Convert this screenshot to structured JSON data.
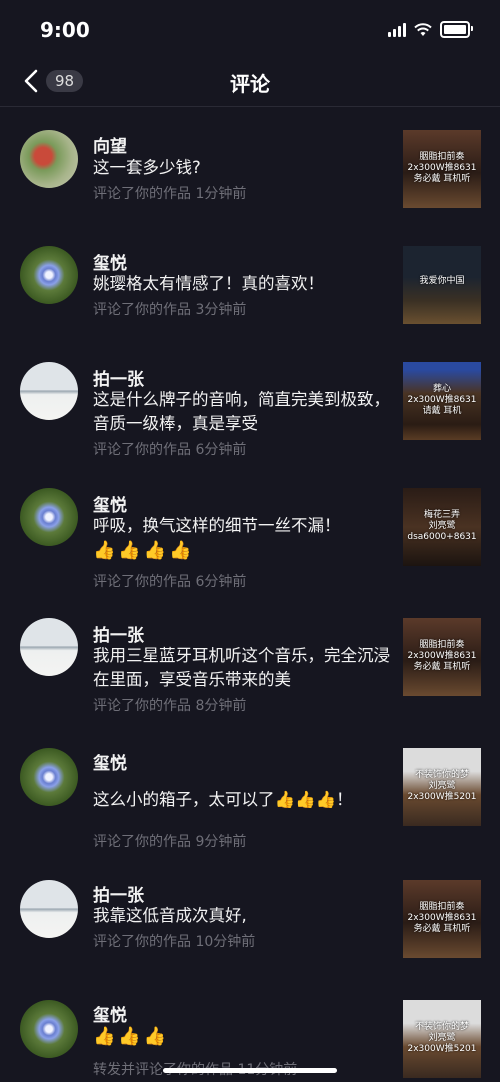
{
  "status": {
    "time": "9:00"
  },
  "nav": {
    "count": "98",
    "title": "评论"
  },
  "comments": [
    {
      "name": "向望",
      "text": "这一套多少钱?",
      "meta": "评论了你的作品  1分钟前",
      "thumb": "胭脂扣前奏\n2x300W推8631\n务必戴  耳机听"
    },
    {
      "name": "玺悦",
      "text": "姚璎格太有情感了！真的喜欢！",
      "meta": "评论了你的作品  3分钟前",
      "thumb": "我爱你中国"
    },
    {
      "name": "拍一张",
      "text": "这是什么牌子的音响，简直完美到极致，音质一级棒，真是享受",
      "meta": "评论了你的作品  6分钟前",
      "thumb": "葬心\n2x300W推8631\n请戴  耳机"
    },
    {
      "name": "玺悦",
      "text": "呼吸，换气这样的细节一丝不漏！",
      "emoji": "👍👍👍👍",
      "meta": "评论了你的作品  6分钟前",
      "thumb": "梅花三弄\n刘亮鹭\ndsa6000+8631"
    },
    {
      "name": "拍一张",
      "text": "我用三星蓝牙耳机听这个音乐，完全沉浸在里面，享受音乐带来的美",
      "meta": "评论了你的作品  8分钟前",
      "thumb": "胭脂扣前奏\n2x300W推8631\n务必戴  耳机听"
    },
    {
      "name": "玺悦",
      "text": "这么小的箱子，太可以了👍👍👍！",
      "meta": "评论了你的作品  9分钟前",
      "thumb": "不装饰你的梦\n刘亮鹭\n2x300W推5201"
    },
    {
      "name": "拍一张",
      "text": "我靠这低音成次真好,",
      "meta": "评论了你的作品  10分钟前",
      "thumb": "胭脂扣前奏\n2x300W推8631\n务必戴  耳机听"
    },
    {
      "name": "玺悦",
      "text": "",
      "emoji": "👍👍👍",
      "meta": "转发并评论了你的作品  11分钟前",
      "thumb": "不装饰你的梦\n刘亮鹭\n2x300W推5201"
    }
  ],
  "colors": {
    "background": "#161620",
    "meta_text": "#6f6f78",
    "badge_bg": "#3a3a45"
  },
  "icons": {
    "back": "chevron-left-icon",
    "wifi": "wifi-icon",
    "signal": "cellular-signal-icon",
    "battery": "battery-icon"
  }
}
